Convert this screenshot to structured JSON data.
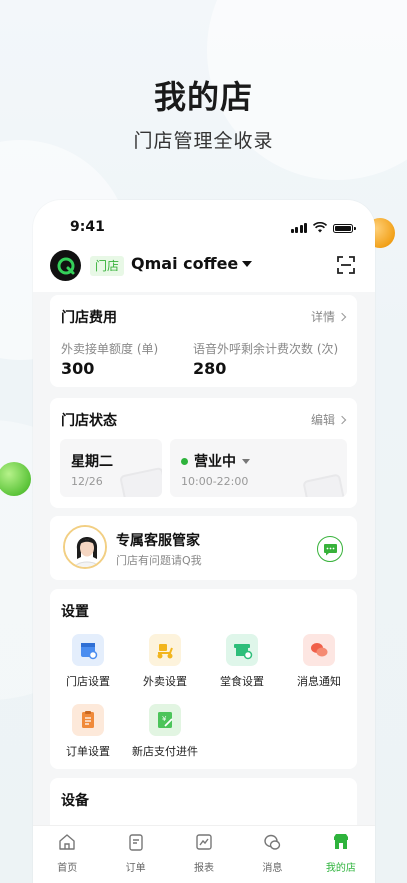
{
  "hero": {
    "title": "我的店",
    "subtitle": "门店管理全收录"
  },
  "status_bar": {
    "time": "9:41"
  },
  "header": {
    "store_tag": "门店",
    "store_name": "Qmai coffee",
    "logo_letter": "Q"
  },
  "fees": {
    "title": "门店费用",
    "link": "详情",
    "items": [
      {
        "label": "外卖接单额度 (单)",
        "value": "300"
      },
      {
        "label": "语音外呼剩余计费次数 (次)",
        "value": "280"
      }
    ]
  },
  "store_status": {
    "title": "门店状态",
    "link": "编辑",
    "day": {
      "label": "星期二",
      "date": "12/26"
    },
    "business": {
      "label": "营业中",
      "hours": "10:00-22:00"
    }
  },
  "customer_service": {
    "title": "专属客服管家",
    "subtitle": "门店有问题请Q我"
  },
  "settings": {
    "title": "设置",
    "items": [
      {
        "label": "门店设置",
        "icon": "store-settings-icon",
        "color": "#4a8df0"
      },
      {
        "label": "外卖设置",
        "icon": "delivery-scooter-icon",
        "color": "#f2b51d"
      },
      {
        "label": "堂食设置",
        "icon": "dine-in-icon",
        "color": "#2dbe7a"
      },
      {
        "label": "消息通知",
        "icon": "message-notify-icon",
        "color": "#f0604a"
      },
      {
        "label": "订单设置",
        "icon": "order-settings-icon",
        "color": "#f08a3a"
      },
      {
        "label": "新店支付进件",
        "icon": "payment-onboarding-icon",
        "color": "#4cc45a"
      }
    ]
  },
  "devices": {
    "title": "设备"
  },
  "tabbar": {
    "tabs": [
      {
        "label": "首页",
        "icon": "home-icon"
      },
      {
        "label": "订单",
        "icon": "order-icon"
      },
      {
        "label": "报表",
        "icon": "report-icon"
      },
      {
        "label": "消息",
        "icon": "message-icon"
      },
      {
        "label": "我的店",
        "icon": "my-store-icon"
      }
    ],
    "active_index": 4
  },
  "colors": {
    "brand_green": "#2eb33c",
    "tag_bg": "#e8f8e6"
  }
}
